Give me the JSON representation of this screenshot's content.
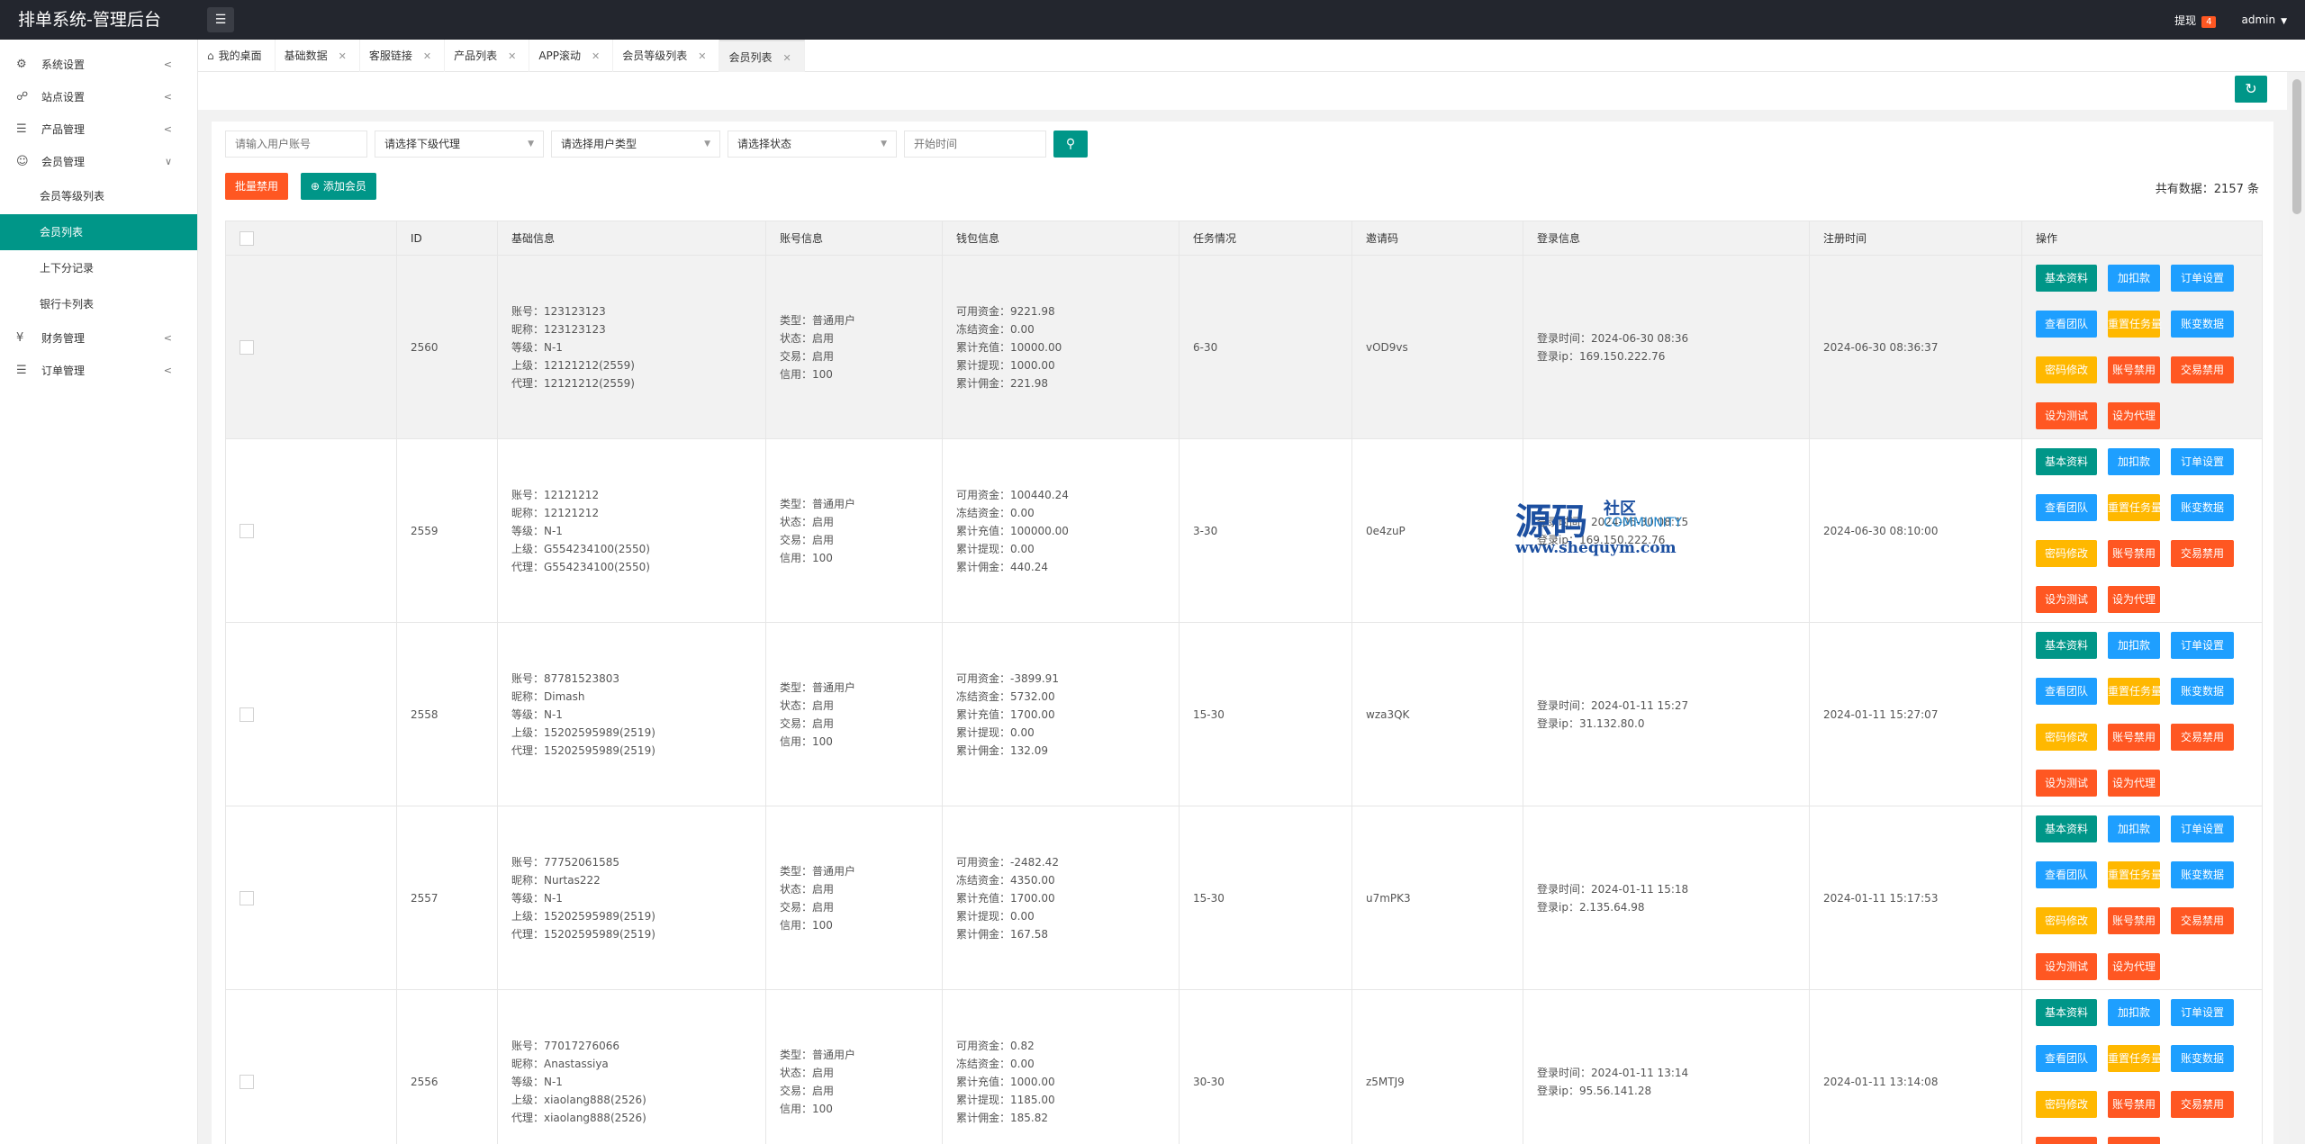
{
  "header": {
    "title": "排单系统-管理后台",
    "menu_icon": "hamburger-icon",
    "withdraw_label": "提现",
    "withdraw_count": "4",
    "user": "admin"
  },
  "sidebar": {
    "items": [
      {
        "label": "系统设置",
        "icon": "gear-icon"
      },
      {
        "label": "站点设置",
        "icon": "globe-icon"
      },
      {
        "label": "产品管理",
        "icon": "layers-icon"
      },
      {
        "label": "会员管理",
        "icon": "user-icon"
      }
    ],
    "member_sub": [
      "会员等级列表",
      "会员列表",
      "上下分记录",
      "银行卡列表"
    ],
    "items_after": [
      {
        "label": "财务管理",
        "icon": "money-icon"
      },
      {
        "label": "订单管理",
        "icon": "layers-icon"
      }
    ]
  },
  "tabs": [
    "我的桌面",
    "基础数据",
    "客服链接",
    "产品列表",
    "APP滚动",
    "会员等级列表",
    "会员列表"
  ],
  "filters": {
    "account_placeholder": "请输入用户账号",
    "agent_select": "请选择下级代理",
    "type_select": "请选择用户类型",
    "status_select": "请选择状态",
    "time_placeholder": "开始时间"
  },
  "actions": {
    "batch_disable": "批量禁用",
    "add_member": "添加会员"
  },
  "total": "共有数据：2157 条",
  "columns": [
    "ID",
    "基础信息",
    "账号信息",
    "钱包信息",
    "任务情况",
    "邀请码",
    "登录信息",
    "注册时间",
    "操作"
  ],
  "op_buttons": [
    "基本资料",
    "加扣款",
    "订单设置",
    "查看团队",
    "重置任务量",
    "账变数据",
    "密码修改",
    "账号禁用",
    "交易禁用",
    "设为测试",
    "设为代理"
  ],
  "rows": [
    {
      "id": "2560",
      "basic": [
        "账号：123123123",
        "昵称：123123123",
        "等级：N-1",
        "上级：12121212(2559)",
        "代理：12121212(2559)"
      ],
      "account": [
        "类型：普通用户",
        "状态：启用",
        "交易：启用",
        "信用：100"
      ],
      "wallet": [
        "可用资金：9221.98",
        "冻结资金：0.00",
        "累计充值：10000.00",
        "累计提现：1000.00",
        "累计佣金：221.98"
      ],
      "task": "6-30",
      "invite": "vOD9vs",
      "login": [
        "登录时间：2024-06-30 08:36",
        "登录ip：169.150.222.76"
      ],
      "reg": "2024-06-30 08:36:37"
    },
    {
      "id": "2559",
      "basic": [
        "账号：12121212",
        "昵称：12121212",
        "等级：N-1",
        "上级：G554234100(2550)",
        "代理：G554234100(2550)"
      ],
      "account": [
        "类型：普通用户",
        "状态：启用",
        "交易：启用",
        "信用：100"
      ],
      "wallet": [
        "可用资金：100440.24",
        "冻结资金：0.00",
        "累计充值：100000.00",
        "累计提现：0.00",
        "累计佣金：440.24"
      ],
      "task": "3-30",
      "invite": "0e4zuP",
      "login": [
        "登录时间：2024-06-30 08:15",
        "登录ip：169.150.222.76"
      ],
      "reg": "2024-06-30 08:10:00"
    },
    {
      "id": "2558",
      "basic": [
        "账号：87781523803",
        "昵称：Dimash",
        "等级：N-1",
        "上级：15202595989(2519)",
        "代理：15202595989(2519)"
      ],
      "account": [
        "类型：普通用户",
        "状态：启用",
        "交易：启用",
        "信用：100"
      ],
      "wallet": [
        "可用资金：-3899.91",
        "冻结资金：5732.00",
        "累计充值：1700.00",
        "累计提现：0.00",
        "累计佣金：132.09"
      ],
      "task": "15-30",
      "invite": "wza3QK",
      "login": [
        "登录时间：2024-01-11 15:27",
        "登录ip：31.132.80.0"
      ],
      "reg": "2024-01-11 15:27:07"
    },
    {
      "id": "2557",
      "basic": [
        "账号：77752061585",
        "昵称：Nurtas222",
        "等级：N-1",
        "上级：15202595989(2519)",
        "代理：15202595989(2519)"
      ],
      "account": [
        "类型：普通用户",
        "状态：启用",
        "交易：启用",
        "信用：100"
      ],
      "wallet": [
        "可用资金：-2482.42",
        "冻结资金：4350.00",
        "累计充值：1700.00",
        "累计提现：0.00",
        "累计佣金：167.58"
      ],
      "task": "15-30",
      "invite": "u7mPK3",
      "login": [
        "登录时间：2024-01-11 15:18",
        "登录ip：2.135.64.98"
      ],
      "reg": "2024-01-11 15:17:53"
    },
    {
      "id": "2556",
      "basic": [
        "账号：77017276066",
        "昵称：Anastassiya",
        "等级：N-1",
        "上级：xiaolang888(2526)",
        "代理：xiaolang888(2526)"
      ],
      "account": [
        "类型：普通用户",
        "状态：启用",
        "交易：启用",
        "信用：100"
      ],
      "wallet": [
        "可用资金：0.82",
        "冻结资金：0.00",
        "累计充值：1000.00",
        "累计提现：1185.00",
        "累计佣金：185.82"
      ],
      "task": "30-30",
      "invite": "z5MTJ9",
      "login": [
        "登录时间：2024-01-11 13:14",
        "登录ip：95.56.141.28"
      ],
      "reg": "2024-01-11 13:14:08"
    }
  ],
  "watermark": {
    "big": "源码",
    "small": "社区",
    "eng": "COMMUNITY",
    "url": "www.shequym.com"
  },
  "colors": {
    "header": "#23262e",
    "teal": "#009688",
    "blue": "#1e9fff",
    "orange": "#ffb800",
    "red": "#ff5722"
  }
}
